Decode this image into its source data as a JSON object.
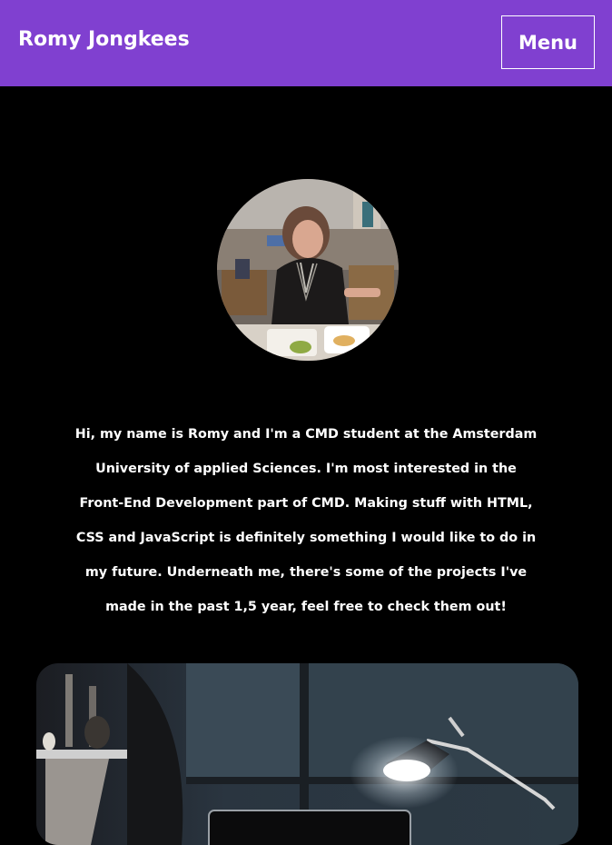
{
  "header": {
    "title": "Romy Jongkees",
    "menu_label": "Menu",
    "background_color": "#8040d0"
  },
  "profile": {
    "avatar_icon": "profile-photo",
    "intro_text": "Hi, my name is Romy and I'm a CMD student at the Amsterdam University of applied Sciences. I'm most interested in the Front-End Development part of CMD. Making stuff with HTML, CSS and JavaScript is definitely something I would like to do in my future. Underneath me, there's some of the projects I've made in the past 1,5 year, feel free to check them out!"
  },
  "projects": {
    "first_card_image": "desk-lamp-laptop-photo"
  }
}
